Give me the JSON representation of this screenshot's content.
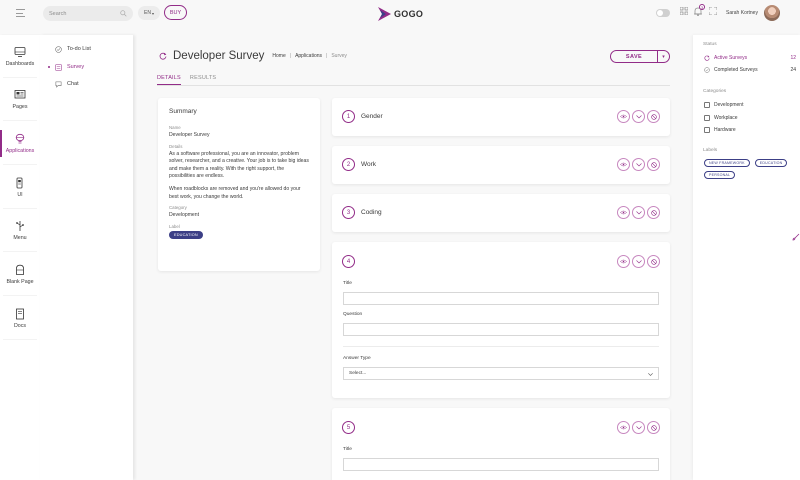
{
  "topbar": {
    "search_placeholder": "Search",
    "language": "EN",
    "buy_label": "BUY",
    "logo_text": "GOGO",
    "notification_count": "3",
    "user_name": "Sarah Kortney"
  },
  "mainnav": {
    "items": [
      {
        "label": "Dashboards",
        "icon": "dashboard-icon"
      },
      {
        "label": "Pages",
        "icon": "pages-icon"
      },
      {
        "label": "Applications",
        "icon": "applications-icon",
        "active": true
      },
      {
        "label": "UI",
        "icon": "ui-icon"
      },
      {
        "label": "Menu",
        "icon": "menu-icon"
      },
      {
        "label": "Blank Page",
        "icon": "blank-page-icon"
      },
      {
        "label": "Docs",
        "icon": "docs-icon"
      }
    ]
  },
  "subnav": {
    "items": [
      {
        "label": "To-do List",
        "icon": "check-circle-icon"
      },
      {
        "label": "Survey",
        "icon": "survey-icon",
        "active": true
      },
      {
        "label": "Chat",
        "icon": "chat-icon"
      }
    ]
  },
  "page": {
    "title": "Developer Survey",
    "breadcrumb": [
      "Home",
      "Applications",
      "Survey"
    ],
    "save_label": "SAVE",
    "tabs": [
      {
        "label": "DETAILS",
        "active": true
      },
      {
        "label": "RESULTS",
        "active": false
      }
    ]
  },
  "summary": {
    "title": "Summary",
    "name_label": "Name",
    "name_value": "Developer Survey",
    "details_label": "Details",
    "details_p1": "As a software professional, you are an innovator, problem solver, researcher, and a creative. Your job is to take big ideas and make them a reality. With the right support, the possibilities are endless.",
    "details_p2": "When roadblocks are removed and you're allowed do your best work, you change the world.",
    "category_label": "Category",
    "category_value": "Development",
    "label_label": "Label",
    "label_value": "EDUCATION"
  },
  "questions": [
    {
      "number": "1",
      "title": "Gender"
    },
    {
      "number": "2",
      "title": "Work"
    },
    {
      "number": "3",
      "title": "Coding"
    },
    {
      "number": "4",
      "title": "",
      "title_field_label": "Title",
      "question_field_label": "Question",
      "answer_type_label": "Answer Type",
      "answer_type_placeholder": "Select..."
    },
    {
      "number": "5",
      "title": "",
      "title_field_label": "Title"
    }
  ],
  "rightpanel": {
    "status_heading": "Status",
    "status_items": [
      {
        "label": "Active Surveys",
        "count": "12",
        "active": true
      },
      {
        "label": "Completed Surveys",
        "count": "24"
      }
    ],
    "categories_heading": "Categories",
    "categories": [
      "Development",
      "Workplace",
      "Hardware"
    ],
    "labels_heading": "Labels",
    "labels": [
      "NEW FRAMEWORK",
      "EDUCATION",
      "PERSONAL"
    ]
  },
  "colors": {
    "accent": "#922c88",
    "badge": "#3c3f86"
  }
}
